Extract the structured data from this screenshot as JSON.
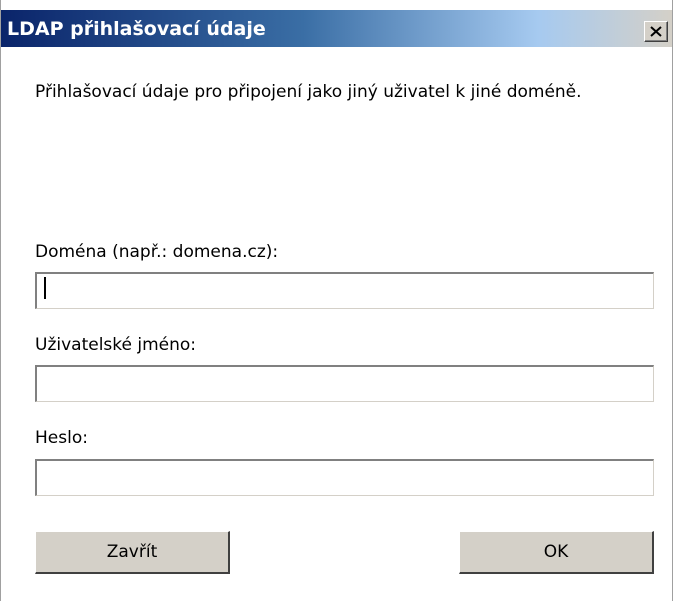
{
  "window": {
    "title": "LDAP přihlašovací údaje",
    "close_label": "×"
  },
  "description": "Přihlašovací údaje pro připojení jako jiný uživatel k jiné doméně.",
  "fields": {
    "domain": {
      "label": "Doména (např.: domena.cz):",
      "value": ""
    },
    "username": {
      "label": "Uživatelské jméno:",
      "value": ""
    },
    "password": {
      "label": "Heslo:",
      "value": ""
    }
  },
  "buttons": {
    "close": "Zavřít",
    "ok": "OK"
  },
  "colors": {
    "titlebar_start": "#0a246a",
    "titlebar_end": "#a6caf0",
    "button_face": "#d4d0c8"
  },
  "icons": {
    "close": "close-icon"
  }
}
